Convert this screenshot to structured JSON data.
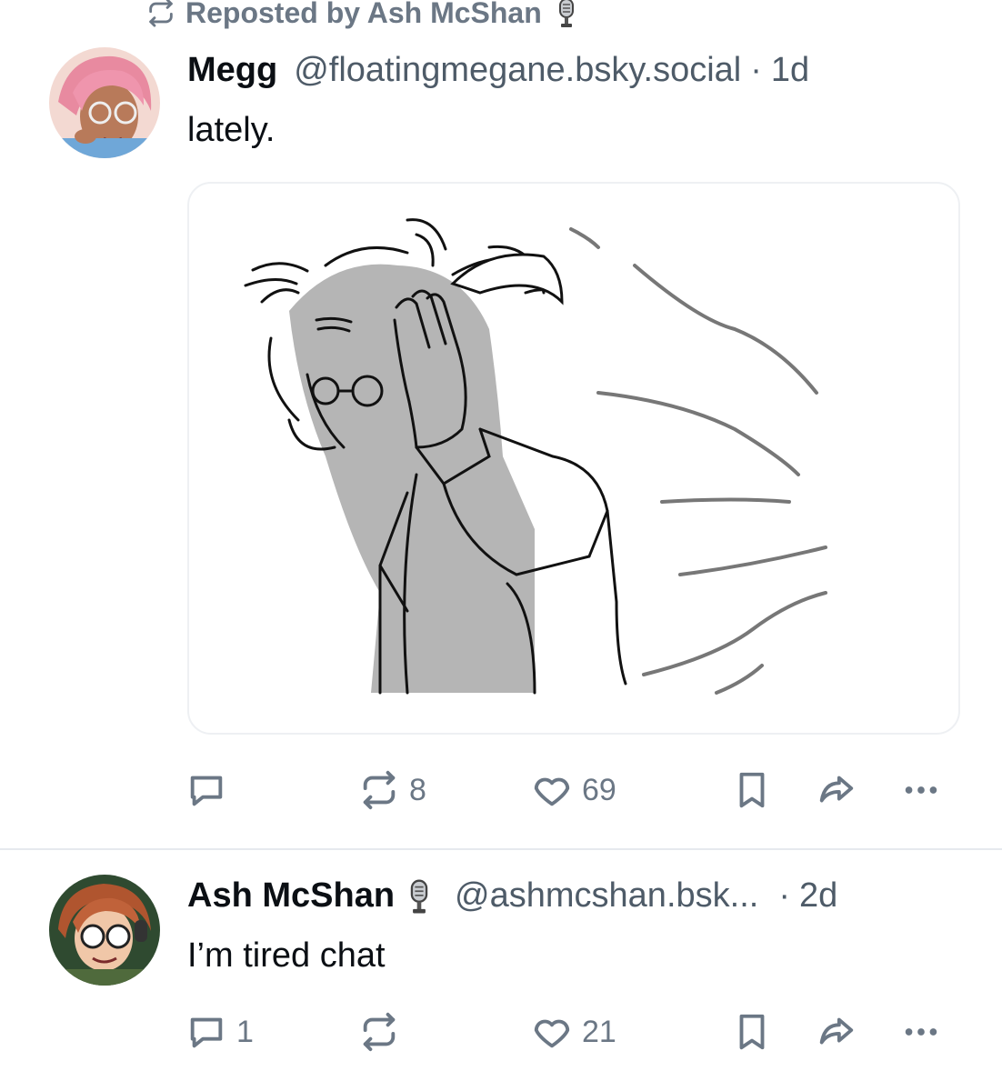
{
  "repost": {
    "prefix": "Reposted by Ash McShan",
    "icon": "repost-icon"
  },
  "post1": {
    "author_name": "Megg",
    "handle": "@floatingmegane.bsky.social",
    "sep": "·",
    "time": "1d",
    "text": "lately.",
    "image_alt": "sketch of character facepalming",
    "actions": {
      "reply_count": "",
      "repost_count": "8",
      "like_count": "69"
    }
  },
  "post2": {
    "author_name": "Ash McShan",
    "handle": "@ashmcshan.bsk...",
    "sep": "·",
    "time": "2d",
    "text": "I’m tired chat",
    "actions": {
      "reply_count": "1",
      "repost_count": "",
      "like_count": "21"
    }
  },
  "colors": {
    "muted": "#6b7785",
    "text": "#0b0f14",
    "divider": "#e6e9ee"
  }
}
